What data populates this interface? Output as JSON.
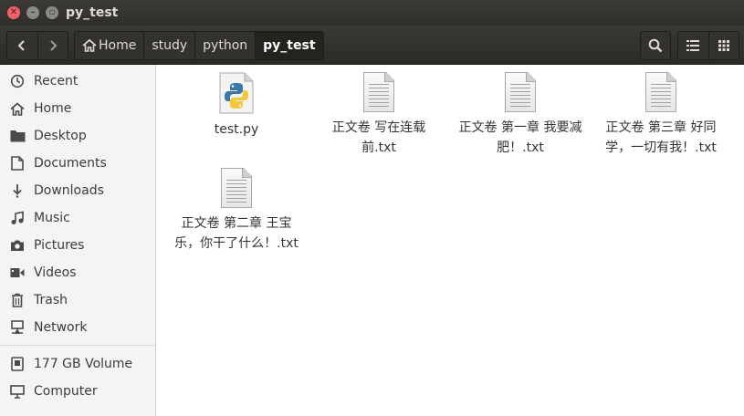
{
  "window": {
    "title": "py_test"
  },
  "breadcrumbs": [
    {
      "label": "Home"
    },
    {
      "label": "study"
    },
    {
      "label": "python"
    },
    {
      "label": "py_test"
    }
  ],
  "sidebar": {
    "items": [
      {
        "label": "Recent",
        "icon": "clock-icon"
      },
      {
        "label": "Home",
        "icon": "home-icon"
      },
      {
        "label": "Desktop",
        "icon": "folder-icon"
      },
      {
        "label": "Documents",
        "icon": "document-icon"
      },
      {
        "label": "Downloads",
        "icon": "download-icon"
      },
      {
        "label": "Music",
        "icon": "music-icon"
      },
      {
        "label": "Pictures",
        "icon": "camera-icon"
      },
      {
        "label": "Videos",
        "icon": "video-icon"
      },
      {
        "label": "Trash",
        "icon": "trash-icon"
      },
      {
        "label": "Network",
        "icon": "network-icon"
      }
    ],
    "devices": [
      {
        "label": "177 GB Volume",
        "icon": "drive-icon"
      },
      {
        "label": "Computer",
        "icon": "computer-icon"
      }
    ]
  },
  "files": [
    {
      "name": "test.py",
      "type": "python"
    },
    {
      "name": "正文卷 写在连载前.txt",
      "type": "text"
    },
    {
      "name": "正文卷 第一章 我要减肥！.txt",
      "type": "text"
    },
    {
      "name": "正文卷 第三章 好同学，一切有我！.txt",
      "type": "text"
    },
    {
      "name": "正文卷 第二章 王宝乐，你干了什么！.txt",
      "type": "text"
    }
  ],
  "colors": {
    "headerbar": "#2f2e2a",
    "close": "#f46067",
    "sidebar": "#f5f4f2"
  }
}
